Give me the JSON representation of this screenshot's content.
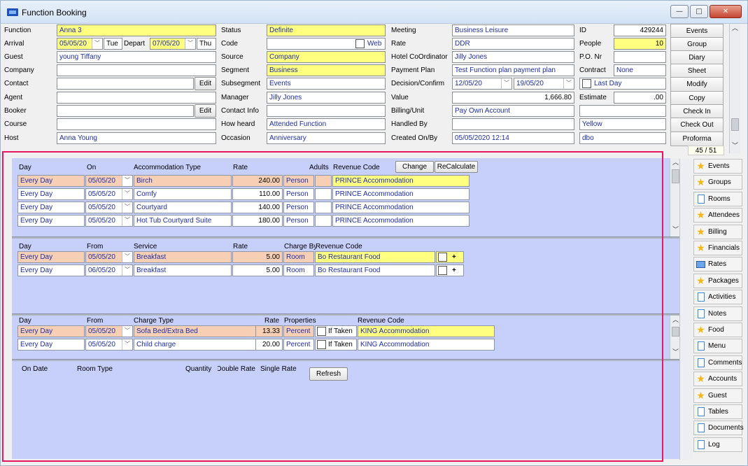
{
  "window": {
    "title": "Function Booking",
    "min_label": "—",
    "max_label": "□",
    "close_label": "✕"
  },
  "form": {
    "function_label": "Function",
    "function_value": "Anna  3",
    "arrival_label": "Arrival",
    "arrival_date": "05/05/20",
    "arrival_day": "Tue",
    "depart_label": "Depart",
    "depart_date": "07/05/20",
    "depart_day": "Thu",
    "guest_label": "Guest",
    "guest_value": "young Tiffany",
    "company_label": "Company",
    "company_value": "",
    "contact_label": "Contact",
    "contact_value": "",
    "contact_edit": "Edit",
    "agent_label": "Agent",
    "agent_value": "",
    "booker_label": "Booker",
    "booker_value": "",
    "booker_edit": "Edit",
    "course_label": "Course",
    "course_value": "",
    "host_label": "Host",
    "host_value": "Anna Young",
    "status_label": "Status",
    "status_value": "Definite",
    "code_label": "Code",
    "code_value": "",
    "web_label": "Web",
    "source_label": "Source",
    "source_value": "Company",
    "segment_label": "Segment",
    "segment_value": "Business",
    "subsegment_label": "Subsegment",
    "subsegment_value": "Events",
    "manager_label": "Manager",
    "manager_value": "Jilly  Jones",
    "contact_info_label": "Contact Info",
    "contact_info_value": "",
    "how_heard_label": "How heard",
    "how_heard_value": "Attended Function",
    "occasion_label": "Occasion",
    "occasion_value": "Anniversary",
    "meeting_label": "Meeting",
    "meeting_value": "Business Leisure",
    "rate_label": "Rate",
    "rate_value": "DDR",
    "hotel_coord_label": "Hotel CoOrdinator",
    "hotel_coord_value": "Jilly  Jones",
    "payment_plan_label": "Payment Plan",
    "payment_plan_value": "Test Function plan payment plan",
    "decision_label": "Decision/Confirm",
    "decision_date": "12/05/20",
    "confirm_date": "19/05/20",
    "value_label": "Value",
    "value_value": "1,666.80",
    "billing_label": "Billing/Unit",
    "billing_value": "Pay Own Account",
    "handled_by_label": "Handled By",
    "handled_by_value": "",
    "created_label": "Created On/By",
    "created_value": "05/05/2020 12:14",
    "id_label": "ID",
    "id_value": "429244",
    "people_label": "People",
    "people_value": "10",
    "po_label": "P.O. Nr",
    "po_value": "",
    "contract_label": "Contract",
    "contract_value": "None",
    "last_day_label": "Last Day",
    "estimate_label": "Estimate",
    "estimate_value": ".00",
    "unit_value": "",
    "handled_color_value": "Yellow",
    "created_by_value": "dbo"
  },
  "right_buttons": [
    "Events",
    "Group",
    "Diary",
    "Sheet",
    "Modify",
    "Copy",
    "Check In",
    "Check Out",
    "Proforma"
  ],
  "counter": "45 / 51",
  "accommodation": {
    "headers": {
      "day": "Day",
      "on": "On",
      "type": "Accommodation Type",
      "rate": "Rate",
      "adults": "Adults",
      "revenue": "Revenue Code"
    },
    "change_button": "Change",
    "recalc_button": "ReCalculate",
    "rows": [
      {
        "day": "Every Day",
        "on": "05/05/20",
        "type": "Birch",
        "rate": "240.00",
        "per": "Person",
        "revenue": "PRINCE Accommodation"
      },
      {
        "day": "Every Day",
        "on": "05/05/20",
        "type": "Comfy",
        "rate": "110.00",
        "per": "Person",
        "revenue": "PRINCE Accommodation"
      },
      {
        "day": "Every Day",
        "on": "05/05/20",
        "type": "Courtyard",
        "rate": "140.00",
        "per": "Person",
        "revenue": "PRINCE Accommodation"
      },
      {
        "day": "Every Day",
        "on": "05/05/20",
        "type": "Hot Tub Courtyard Suite",
        "rate": "180.00",
        "per": "Person",
        "revenue": "PRINCE Accommodation"
      }
    ]
  },
  "services": {
    "headers": {
      "day": "Day",
      "from": "From",
      "service": "Service",
      "rate": "Rate",
      "charge": "Charge By",
      "revenue": "Revenue Code"
    },
    "rows": [
      {
        "day": "Every Day",
        "from": "05/05/20",
        "service": "Breakfast",
        "rate": "5.00",
        "per": "Room",
        "revenue": "Bo Restaurant Food"
      },
      {
        "day": "Every Day",
        "from": "06/05/20",
        "service": "Breakfast",
        "rate": "5.00",
        "per": "Room",
        "revenue": "Bo Restaurant Food"
      }
    ]
  },
  "charges": {
    "headers": {
      "day": "Day",
      "from": "From",
      "type": "Charge Type",
      "rate": "Rate",
      "props": "Properties",
      "revenue": "Revenue Code"
    },
    "rows": [
      {
        "day": "Every Day",
        "from": "05/05/20",
        "type": "Sofa Bed/Extra Bed",
        "rate": "13.33",
        "per": "Percent",
        "if_taken": "If Taken",
        "revenue": "KING Accommodation"
      },
      {
        "day": "Every Day",
        "from": "05/05/20",
        "type": "Child charge",
        "rate": "20.00",
        "per": "Percent",
        "if_taken": "If Taken",
        "revenue": "KING Accommodation"
      }
    ]
  },
  "room_rates": {
    "headers": {
      "on_date": "On Date",
      "room_type": "Room Type",
      "quantity": "Quantity",
      "double": "Double Rate",
      "single": "Single Rate"
    },
    "refresh_button": "Refresh"
  },
  "nav": [
    {
      "label": "Events",
      "icon": "star-icon"
    },
    {
      "label": "Groups",
      "icon": "star-icon"
    },
    {
      "label": "Rooms",
      "icon": "doc-icon"
    },
    {
      "label": "Attendees",
      "icon": "star-icon"
    },
    {
      "label": "Billing",
      "icon": "star-icon"
    },
    {
      "label": "Financials",
      "icon": "star-icon"
    },
    {
      "label": "Rates",
      "icon": "rates-icon"
    },
    {
      "label": "Packages",
      "icon": "star-icon"
    },
    {
      "label": "Activities",
      "icon": "doc-icon"
    },
    {
      "label": "Notes",
      "icon": "doc-icon"
    },
    {
      "label": "Food",
      "icon": "star-icon"
    },
    {
      "label": "Menu",
      "icon": "doc-icon"
    },
    {
      "label": "Comments",
      "icon": "doc-icon"
    },
    {
      "label": "Accounts",
      "icon": "star-icon"
    },
    {
      "label": "Guest",
      "icon": "star-icon"
    },
    {
      "label": "Tables",
      "icon": "doc-icon"
    },
    {
      "label": "Documents",
      "icon": "doc-icon"
    },
    {
      "label": "Log",
      "icon": "doc-icon"
    }
  ],
  "colors": {
    "highlight": "#e6185f",
    "pane": "#c7cffb",
    "row_pink": "#f7cfb4",
    "field_yellow": "#ffff80",
    "text_blue": "#1e2ea8"
  }
}
